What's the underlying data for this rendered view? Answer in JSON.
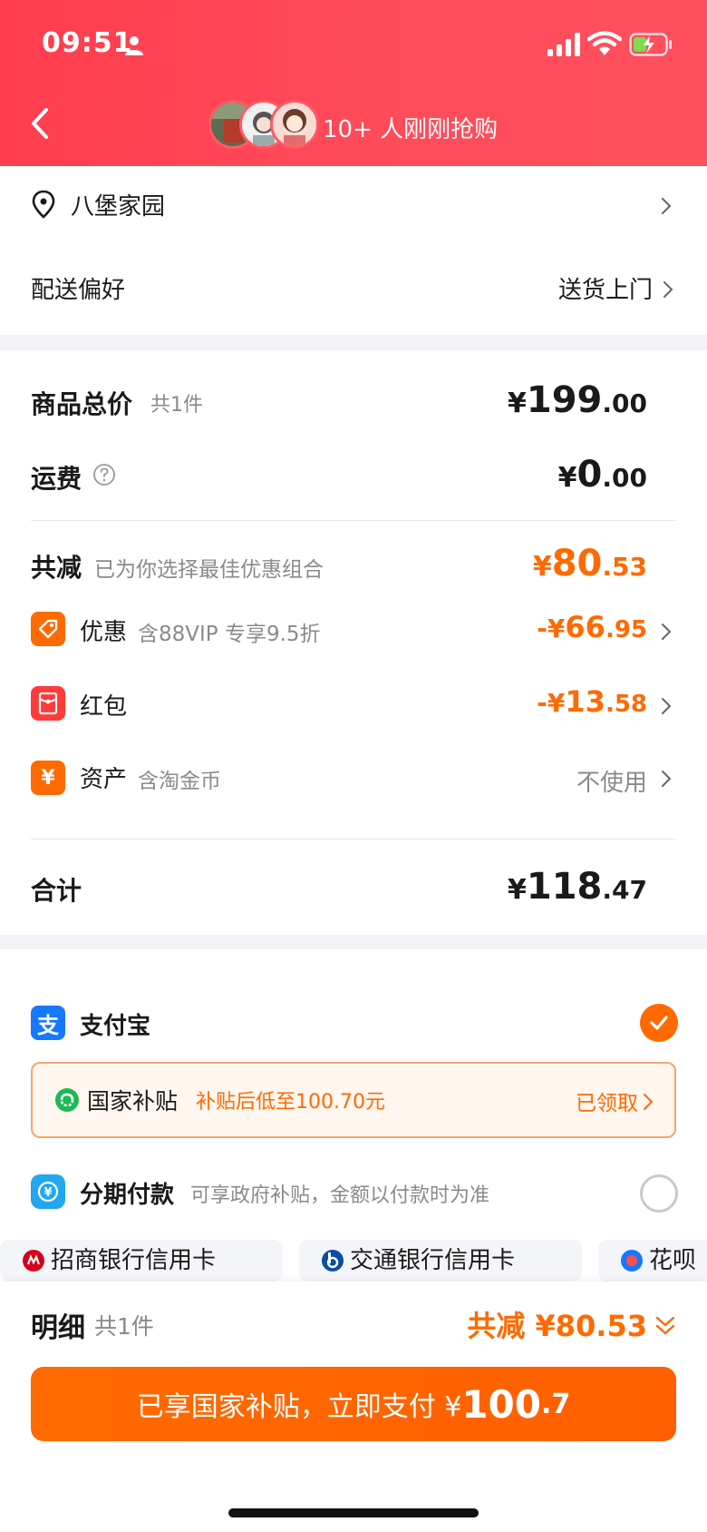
{
  "status": {
    "time": "09:51"
  },
  "header": {
    "buyers_text": "10+ 人刚刚抢购"
  },
  "address": {
    "name": "八堡家园"
  },
  "delivery": {
    "label": "配送偏好",
    "value": "送货上门"
  },
  "summary": {
    "goods_label": "商品总价",
    "goods_count": "共1件",
    "goods_price": {
      "currency": "¥",
      "int": "199",
      "dec": ".00"
    },
    "shipping_label": "运费",
    "shipping_price": {
      "currency": "¥",
      "int": "0",
      "dec": ".00"
    },
    "discount_label": "共减",
    "discount_note": "已为你选择最佳优惠组合",
    "discount_total": {
      "currency": "¥",
      "int": "80",
      "dec": ".53"
    },
    "coupon_label": "优惠",
    "coupon_note": "含88VIP 专享9.5折",
    "coupon_value": {
      "currency": "-¥",
      "int": "66",
      "dec": ".95"
    },
    "redpacket_label": "红包",
    "redpacket_value": {
      "currency": "-¥",
      "int": "13",
      "dec": ".58"
    },
    "assets_label": "资产",
    "assets_note": "含淘金币",
    "assets_value": "不使用",
    "total_label": "合计",
    "total_price": {
      "currency": "¥",
      "int": "118",
      "dec": ".47"
    }
  },
  "payment": {
    "alipay_label": "支付宝",
    "subsidy_title": "国家补贴",
    "subsidy_note": "补贴后低至100.70元",
    "subsidy_status": "已领取",
    "installment_label": "分期付款",
    "installment_note": "可享政府补贴，金额以付款时为准",
    "banks": [
      "招商银行信用卡",
      "交通银行信用卡",
      "花呗"
    ]
  },
  "footer": {
    "detail_label": "明细",
    "detail_count": "共1件",
    "discount_text": "共减 ¥80.53",
    "pay_text": "已享国家补贴，立即支付 ¥",
    "pay_int": "100",
    "pay_dec": ".7"
  },
  "colors": {
    "brand_red": "#ff3d4e",
    "accent_orange": "#ff6a00"
  }
}
